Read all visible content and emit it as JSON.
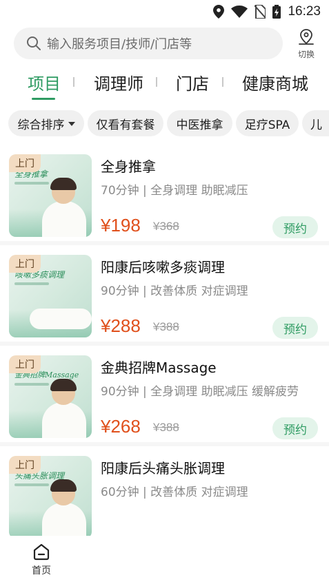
{
  "statusbar": {
    "time": "16:23"
  },
  "search": {
    "placeholder": "输入服务项目/技师/门店等",
    "switch_label": "切换"
  },
  "tabs": [
    {
      "label": "项目",
      "active": true
    },
    {
      "label": "调理师",
      "active": false
    },
    {
      "label": "门店",
      "active": false
    },
    {
      "label": "健康商城",
      "active": false
    }
  ],
  "filters": [
    {
      "label": "综合排序",
      "dropdown": true
    },
    {
      "label": "仅看有套餐"
    },
    {
      "label": "中医推拿"
    },
    {
      "label": "足疗SPA"
    },
    {
      "label": "儿"
    }
  ],
  "items": [
    {
      "badge": "上门",
      "thumb_text": "全身推拿",
      "title": "全身推拿",
      "meta": "70分钟 | 全身调理 助眠减压",
      "price": "¥198",
      "original_price": "¥368",
      "button": "预约"
    },
    {
      "badge": "上门",
      "thumb_text": "咳嗽多痰调理",
      "title": "阳康后咳嗽多痰调理",
      "meta": "90分钟 | 改善体质 对症调理",
      "price": "¥288",
      "original_price": "¥388",
      "button": "预约"
    },
    {
      "badge": "上门",
      "thumb_text": "金典招牌Massage",
      "title": "金典招牌Massage",
      "meta": "90分钟 | 全身调理 助眠减压 缓解疲劳",
      "price": "¥268",
      "original_price": "¥388",
      "button": "预约"
    },
    {
      "badge": "上门",
      "thumb_text": "头痛头胀调理",
      "title": "阳康后头痛头胀调理",
      "meta": "60分钟 | 改善体质 对症调理",
      "price": "",
      "original_price": "",
      "button": ""
    }
  ],
  "bottom_nav": {
    "home_label": "首页"
  },
  "colors": {
    "accent": "#2e9b62",
    "price": "#e0501c",
    "badge": "#f3dcc2"
  }
}
